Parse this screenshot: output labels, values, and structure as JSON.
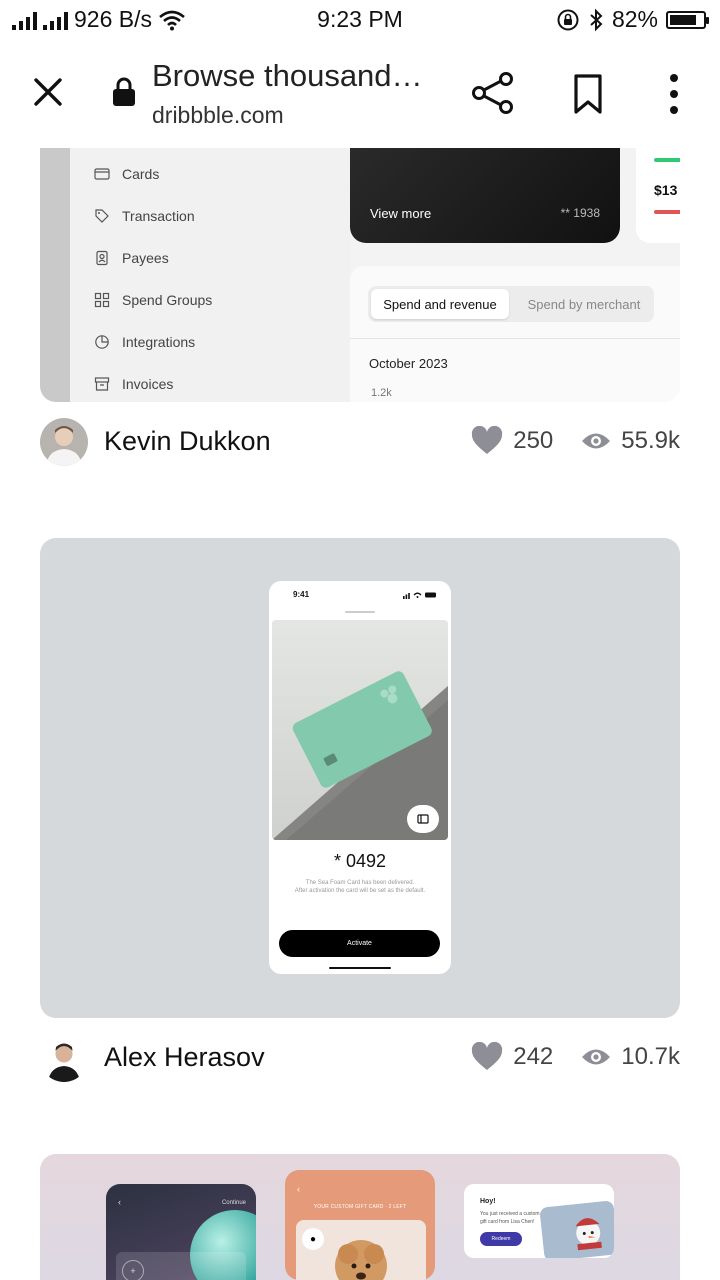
{
  "status_bar": {
    "network_speed": "926 B/s",
    "time": "9:23 PM",
    "battery": "82%"
  },
  "browser": {
    "title": "Browse thousand…",
    "domain": "dribbble.com",
    "icons": [
      "close-icon",
      "lock-icon",
      "share-icon",
      "bookmark-icon",
      "more-icon"
    ]
  },
  "shots": [
    {
      "sidebar_items": [
        "Cards",
        "Transaction",
        "Payees",
        "Spend Groups",
        "Integrations",
        "Invoices"
      ],
      "card_view_more": "View more",
      "card_number": "** 1938",
      "mini_value": "$13",
      "tab_active": "Spend and revenue",
      "tab_inactive": "Spend by merchant",
      "month": "October 2023",
      "axis_value": "1.2k",
      "author": "Kevin Dukkon",
      "likes": "250",
      "views": "55.9k"
    },
    {
      "phone_time": "9:41",
      "card_digits": "0492",
      "description_line1": "The Sea Foam Card has been delivered.",
      "description_line2": "After activation the card will be set as the default.",
      "activate_label": "Activate",
      "author": "Alex Herasov",
      "likes": "242",
      "views": "10.7k"
    },
    {
      "continue_label": "Continue",
      "gift_label": "YOUR CUSTOM GIFT CARD · 2 LEFT",
      "hoy_title": "Hoy!",
      "hoy_line1": "You just received a custom",
      "hoy_line2": "gift card from Lisa Chen!",
      "redeem_label": "Redeem"
    }
  ],
  "colors": {
    "shot2_bg": "#d6d9dc",
    "card_green": "#7fc7ac",
    "chart_green": "#2ecc71",
    "chart_red": "#e05555",
    "redeem_blue": "#3f3aa6"
  }
}
